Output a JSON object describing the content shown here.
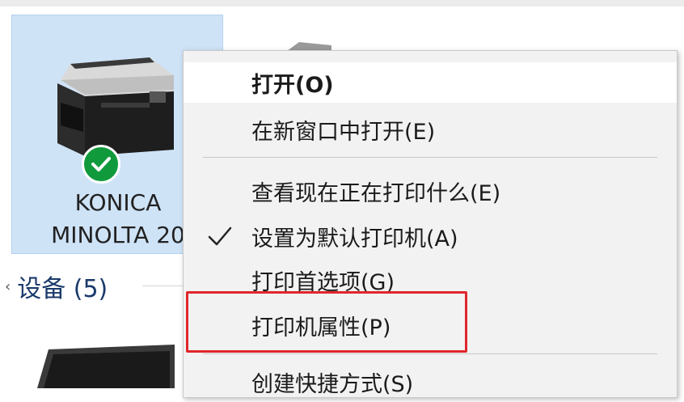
{
  "printer": {
    "name_line1": "KONICA",
    "name_line2": "MINOLTA 20",
    "status": "default"
  },
  "devices_section": {
    "label": "设备 (5)"
  },
  "context_menu": {
    "items": [
      {
        "label": "打开(O)",
        "bold": true
      },
      {
        "label": "在新窗口中打开(E)"
      },
      {
        "label": "查看现在正在打印什么(E)"
      },
      {
        "label": "设置为默认打印机(A)",
        "checked": true
      },
      {
        "label": "打印首选项(G)"
      },
      {
        "label": "打印机属性(P)",
        "highlighted": true
      },
      {
        "label": "创建快捷方式(S)"
      }
    ]
  },
  "colors": {
    "selection_bg": "#cfe3f7",
    "check_green": "#119a3c",
    "highlight_red": "#e0262c",
    "menu_bg": "#f2f2f2"
  },
  "icons": [
    "printer-icon",
    "default-check-icon",
    "checkmark-icon",
    "chevron-icon",
    "laptop-icon"
  ]
}
